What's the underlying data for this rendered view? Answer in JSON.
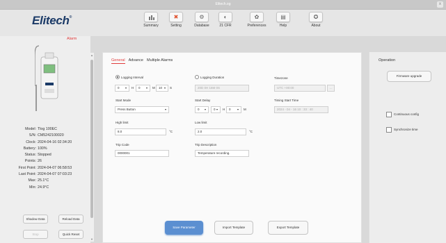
{
  "window": {
    "title": "Elitech.og",
    "close": "x"
  },
  "brand": {
    "logo": "Elitech",
    "reg": "®"
  },
  "nav": [
    {
      "label": "Summary",
      "icon": "chart-icon"
    },
    {
      "label": "Setting",
      "icon": "tools-icon"
    },
    {
      "label": "Database",
      "icon": "database-icon"
    },
    {
      "label": "21 CFR",
      "icon": "shield-icon"
    },
    {
      "label": "Preferences",
      "icon": "gear-icon"
    },
    {
      "label": "Help",
      "icon": "book-icon"
    },
    {
      "label": "About",
      "icon": "info-icon"
    }
  ],
  "device": {
    "alarm": "Alarm",
    "info": [
      {
        "k": "Model:",
        "v": "Tlog 100EC"
      },
      {
        "k": "S/N:",
        "v": "CM5242100020"
      },
      {
        "k": "Clock:",
        "v": "2024-04-16 02:34:20"
      },
      {
        "k": "Battery:",
        "v": "100%"
      },
      {
        "k": "Status:",
        "v": "Stopped"
      },
      {
        "k": "Points:",
        "v": "26"
      },
      {
        "k": "First Point:",
        "v": "2024-04-07 06:58:53"
      },
      {
        "k": "Last Point:",
        "v": "2024-04-07 07:03:23"
      },
      {
        "k": "Max:",
        "v": "25.1°C"
      },
      {
        "k": "Min:",
        "v": "24.9°C"
      }
    ],
    "buttons": {
      "shadow": "Shadow Data",
      "reload": "Reload Data",
      "stop": "Stop",
      "quick_reset": "Quick Reset"
    }
  },
  "tabs": [
    "General",
    "Advance",
    "Multiple Alarms"
  ],
  "general": {
    "logging_interval": "Logging Interval",
    "li_d": "0",
    "li_h": "0",
    "li_m": "10",
    "li_s": "5",
    "lab_h": "H",
    "lab_m": "M",
    "lab_s": "S",
    "logging_duration": "Logging Duration",
    "duration_value": "20D 0H 16M 0S",
    "timezone": "Timezone",
    "timezone_value": "UTC +00:00",
    "start_mode": "Start Mode",
    "start_mode_value": "Press Button",
    "start_delay": "Start Delay",
    "sd_d": "0",
    "sd_h": "0",
    "sd_m": "0",
    "timing_start": "Timing Start Time",
    "timing_value": "2024 - 04 - 16 10 : 33 : 40",
    "high_limit": "High limit",
    "high_value": "8.0",
    "low_limit": "Low limit",
    "low_value": "2.0",
    "unit": "°C",
    "trip_code": "Trip Code",
    "trip_code_value": "0000001",
    "trip_desc": "Trip Description",
    "trip_desc_value": "Temperature recording."
  },
  "actions": {
    "save": "Save Parameter",
    "import": "Import Template",
    "export": "Export Template"
  },
  "operation": {
    "title": "Operation",
    "firmware": "Firmware upgrade",
    "continuous": "Continuous config",
    "sync": "Synchronize time"
  }
}
